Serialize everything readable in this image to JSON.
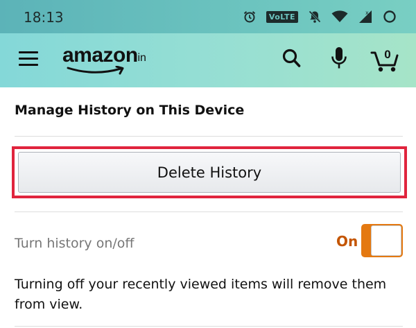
{
  "status_bar": {
    "time": "18:13",
    "volte_label": "VoLTE",
    "icons": [
      "alarm-icon",
      "volte-icon",
      "notifications-off-icon",
      "wifi-icon",
      "signal-icon",
      "data-saver-icon"
    ]
  },
  "header": {
    "logo_text": "amazon",
    "logo_suffix": ".in",
    "cart_count": "0",
    "icons": [
      "menu-icon",
      "search-icon",
      "microphone-icon",
      "cart-icon"
    ],
    "colors": {
      "gradient_start": "#84d8d8",
      "gradient_end": "#a6e4c8"
    }
  },
  "main": {
    "section_title": "Manage History on This Device",
    "delete_button_label": "Delete History",
    "toggle_label": "Turn history on/off",
    "toggle_state": "On",
    "toggle_on": true,
    "description": "Turning off your recently viewed items will remove them from view.",
    "colors": {
      "highlight": "#e0243d",
      "toggle_accent": "#e47911",
      "toggle_text": "#c45500"
    }
  }
}
